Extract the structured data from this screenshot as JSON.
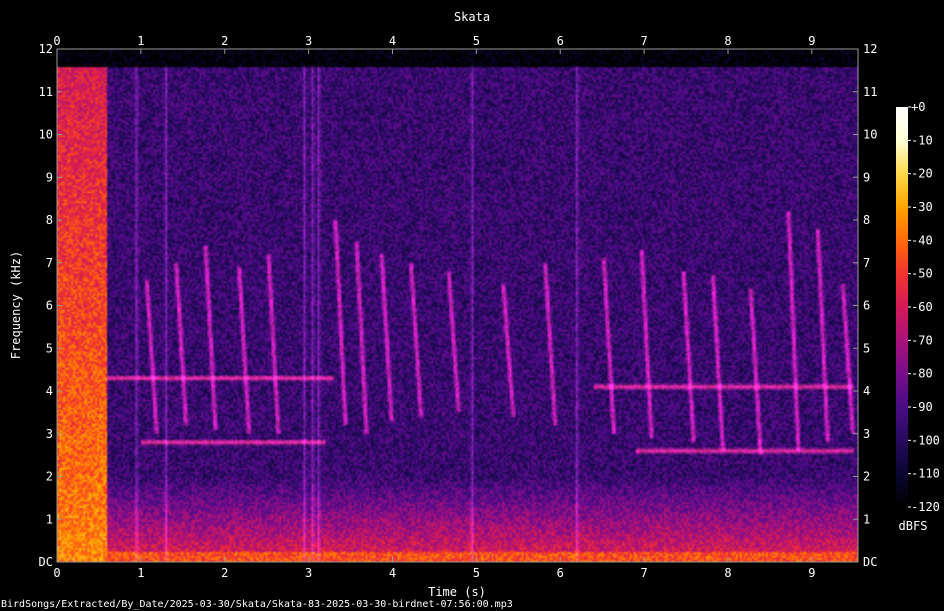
{
  "chart_data": {
    "type": "heatmap",
    "title": "Skata",
    "xlabel": "Time (s)",
    "ylabel": "Frequency (kHz)",
    "xlim": [
      0,
      9.55
    ],
    "ylim": [
      0,
      12
    ],
    "x_ticks": [
      "0",
      "1",
      "2",
      "3",
      "4",
      "5",
      "6",
      "7",
      "8",
      "9"
    ],
    "y_ticks": [
      "DC",
      "1",
      "2",
      "3",
      "4",
      "5",
      "6",
      "7",
      "8",
      "9",
      "10",
      "11",
      "12"
    ],
    "colorbar": {
      "label": "dBFS",
      "range": [
        -120,
        0
      ],
      "ticks": [
        "+0",
        "-10",
        "-20",
        "-30",
        "-40",
        "-50",
        "-60",
        "-70",
        "-80",
        "-90",
        "-100",
        "-110",
        "-120"
      ],
      "colors": [
        "#000000",
        "#0a0630",
        "#260a5e",
        "#4a0c85",
        "#780d8a",
        "#a8127a",
        "#d41a58",
        "#f0342e",
        "#ff6a0a",
        "#ffa400",
        "#ffd84a",
        "#ffffd8",
        "#ffffff"
      ]
    },
    "background_noise_dbfs": -95,
    "low_band_energy_below_khz": 2.0,
    "broadband_onset": {
      "t_start": 0.0,
      "t_end": 0.6,
      "f_max_khz": 11.6,
      "peak_dbfs": -35
    },
    "clicks_s": [
      0.95,
      1.3,
      2.95,
      3.05,
      3.12,
      4.95,
      6.2
    ],
    "harmonic_tracks": [
      {
        "t_start": 0.6,
        "t_end": 3.3,
        "f_khz": 4.3
      },
      {
        "t_start": 6.4,
        "t_end": 9.5,
        "f_khz": 4.1
      },
      {
        "t_start": 1.0,
        "t_end": 3.2,
        "f_khz": 2.8
      },
      {
        "t_start": 6.9,
        "t_end": 9.5,
        "f_khz": 2.6
      }
    ],
    "calls": [
      {
        "t": 1.15,
        "f_top_khz": 6.6,
        "f_bottom_khz": 3.0
      },
      {
        "t": 1.5,
        "f_top_khz": 7.0,
        "f_bottom_khz": 3.2
      },
      {
        "t": 1.85,
        "f_top_khz": 7.4,
        "f_bottom_khz": 3.1
      },
      {
        "t": 2.25,
        "f_top_khz": 6.9,
        "f_bottom_khz": 3.0
      },
      {
        "t": 2.6,
        "f_top_khz": 7.2,
        "f_bottom_khz": 3.0
      },
      {
        "t": 3.4,
        "f_top_khz": 8.0,
        "f_bottom_khz": 3.2
      },
      {
        "t": 3.65,
        "f_top_khz": 7.5,
        "f_bottom_khz": 3.0
      },
      {
        "t": 3.95,
        "f_top_khz": 7.2,
        "f_bottom_khz": 3.3
      },
      {
        "t": 4.3,
        "f_top_khz": 7.0,
        "f_bottom_khz": 3.4
      },
      {
        "t": 4.75,
        "f_top_khz": 6.8,
        "f_bottom_khz": 3.5
      },
      {
        "t": 5.4,
        "f_top_khz": 6.5,
        "f_bottom_khz": 3.4
      },
      {
        "t": 5.9,
        "f_top_khz": 7.0,
        "f_bottom_khz": 3.2
      },
      {
        "t": 6.6,
        "f_top_khz": 7.1,
        "f_bottom_khz": 3.0
      },
      {
        "t": 7.05,
        "f_top_khz": 7.3,
        "f_bottom_khz": 2.9
      },
      {
        "t": 7.55,
        "f_top_khz": 6.8,
        "f_bottom_khz": 2.8
      },
      {
        "t": 7.9,
        "f_top_khz": 6.7,
        "f_bottom_khz": 2.6
      },
      {
        "t": 8.35,
        "f_top_khz": 6.4,
        "f_bottom_khz": 2.5
      },
      {
        "t": 8.8,
        "f_top_khz": 8.2,
        "f_bottom_khz": 2.6
      },
      {
        "t": 9.15,
        "f_top_khz": 7.8,
        "f_bottom_khz": 2.8
      },
      {
        "t": 9.45,
        "f_top_khz": 6.5,
        "f_bottom_khz": 3.0
      }
    ]
  },
  "footer": {
    "file_path": "BirdSongs/Extracted/By_Date/2025-03-30/Skata/Skata-83-2025-03-30-birdnet-07:56:00.mp3"
  }
}
